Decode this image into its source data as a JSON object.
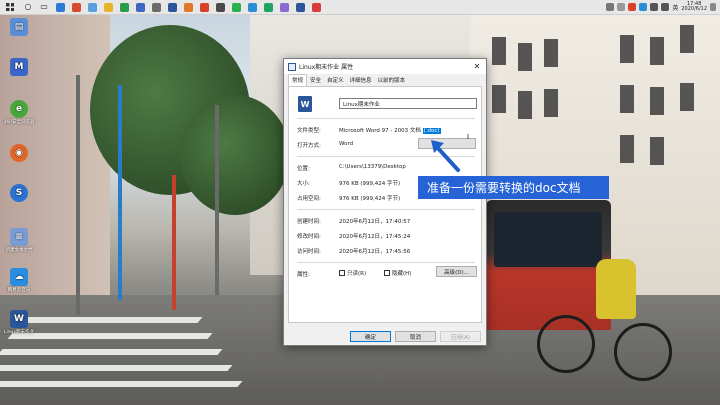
{
  "taskbar": {
    "time": "17:48",
    "ime": "英",
    "date": "2020/6/12"
  },
  "desktop": {
    "icons": [
      {
        "label": "",
        "icon": "file-icon",
        "color": "#5a8fd8"
      },
      {
        "label": "",
        "icon": "app-m-icon",
        "color": "#3b67c9"
      },
      {
        "label": "360安全浏览器",
        "icon": "browser-e-icon",
        "color": "#46a83a"
      },
      {
        "label": "",
        "icon": "firefox-icon",
        "color": "#e0662a"
      },
      {
        "label": "",
        "icon": "sogou-icon",
        "color": "#2a73d0"
      },
      {
        "label": "新建文本文档",
        "icon": "text-file-icon",
        "color": "#7a9bd3"
      },
      {
        "label": "网易云音乐",
        "icon": "cloud-music-icon",
        "color": "#2b8de0"
      },
      {
        "label": "Linux期末作业",
        "icon": "word-doc-icon",
        "color": "#2b579a"
      }
    ]
  },
  "dialog": {
    "title": "Linux期末作业 属性",
    "close_label": "✕",
    "tabs": [
      "常规",
      "安全",
      "自定义",
      "详细信息",
      "以前的版本"
    ],
    "active_tab": "常规",
    "file_name": "Linux期末作业",
    "fields": {
      "file_type_label": "文件类型:",
      "file_type_value": "Microsoft Word 97 - 2003 文档",
      "file_type_ext": "(.doc)",
      "open_with_label": "打开方式:",
      "open_with_value": "Word",
      "location_label": "位置:",
      "location_value": "C:\\Users\\13379\\Desktop",
      "size_label": "大小:",
      "size_value": "976 KB (999,424 字节)",
      "disk_size_label": "占用空间:",
      "disk_size_value": "976 KB (999,424 字节)",
      "created_label": "创建时间:",
      "created_value": "2020年6月12日，17:40:57",
      "modified_label": "修改时间:",
      "modified_value": "2020年6月12日，17:45:24",
      "accessed_label": "访问时间:",
      "accessed_value": "2020年6月12日，17:45:56",
      "attributes_label": "属性:",
      "readonly_label": "只读(R)",
      "hidden_label": "隐藏(H)"
    },
    "buttons": {
      "change": "",
      "advanced": "高级(D)...",
      "ok": "确定",
      "cancel": "取消",
      "apply": "应用(A)"
    }
  },
  "annotation": {
    "text": "准备一份需要转换的doc文档",
    "color": "#2563d6"
  }
}
